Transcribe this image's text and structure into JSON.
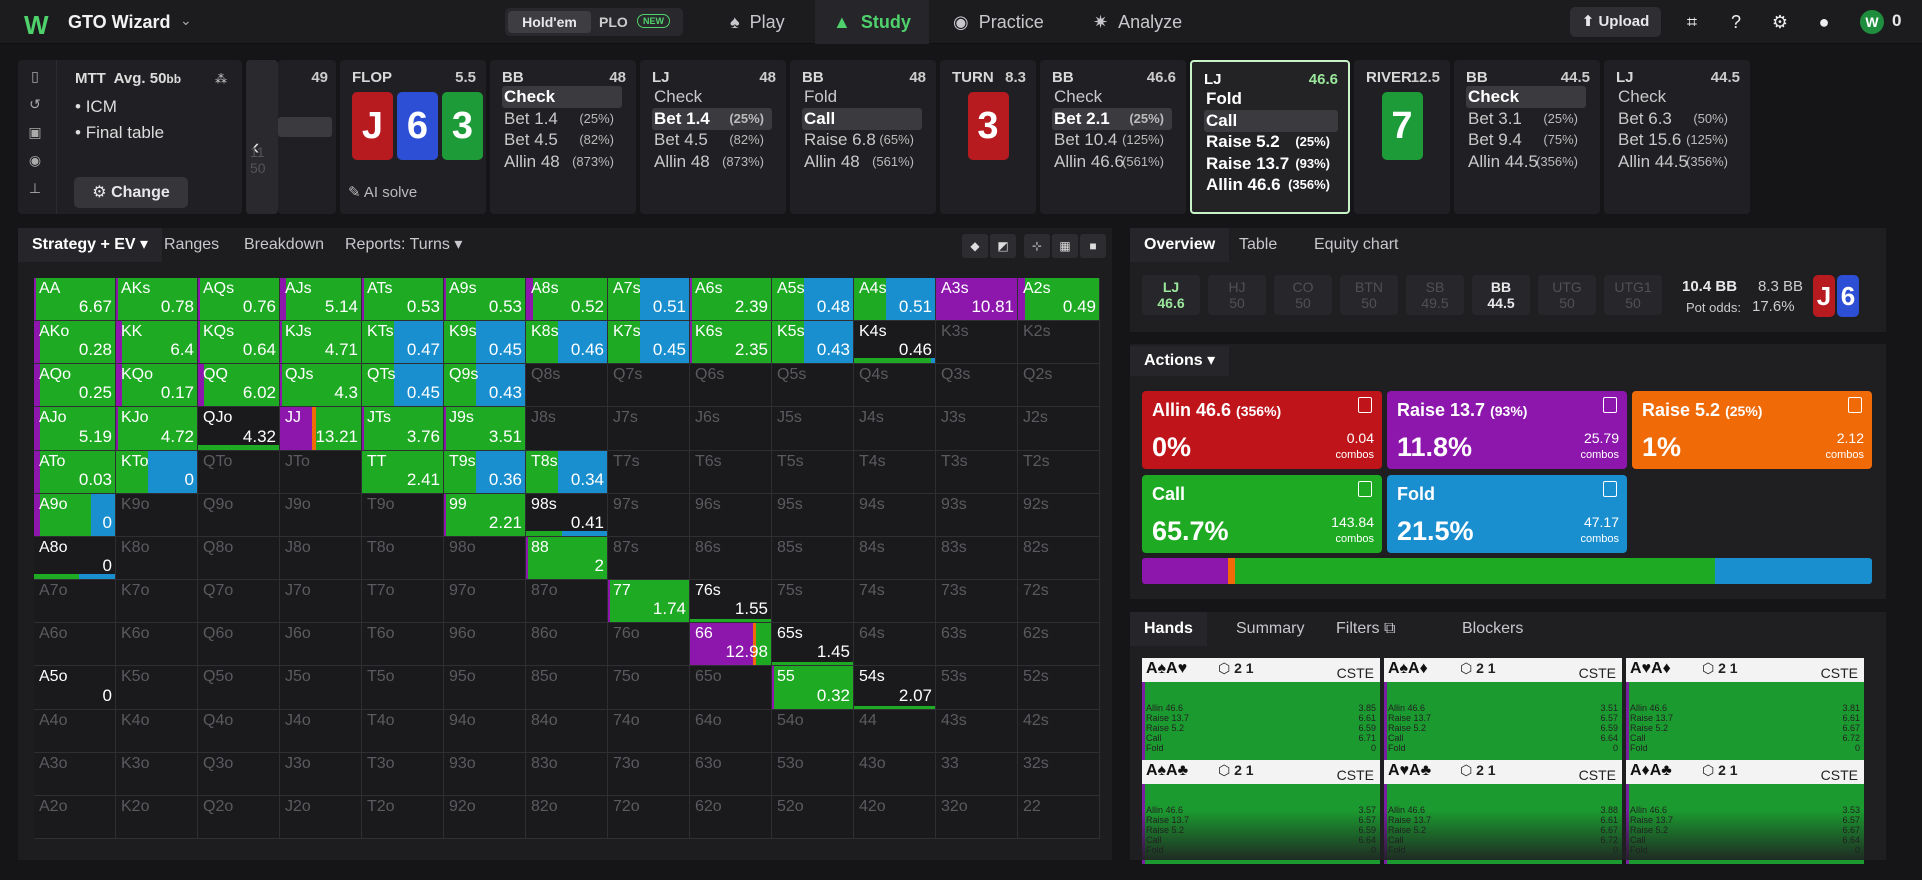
{
  "app": {
    "logo": "W",
    "name": "GTO Wizard",
    "mode_on": "Hold'em",
    "mode_off": "PLO",
    "mode_badge": "NEW",
    "nav": [
      {
        "label": "Play",
        "icon": "spade-icon"
      },
      {
        "label": "Study",
        "icon": "grad-cap-icon"
      },
      {
        "label": "Practice",
        "icon": "gamepad-icon"
      },
      {
        "label": "Analyze",
        "icon": "bulb-icon"
      }
    ],
    "upload": "Upload",
    "coins": "0"
  },
  "colors": {
    "raise_big": "#c0141b",
    "raise": "#8d16ad",
    "raise_small": "#f06a08",
    "call": "#1eaa22",
    "fold": "#1a8fd0",
    "empty": "#1a1a1d"
  },
  "spot": {
    "format": "MTT",
    "avg": "Avg. 50",
    "avg_unit": "bb",
    "bullets": [
      "ICM",
      "Final table"
    ],
    "change": "Change",
    "stack_top": "49",
    "stack_mid": "11",
    "stack_low": "50",
    "ai_solve": "AI solve"
  },
  "street": [
    {
      "pos": "FLOP",
      "num": "5.5",
      "cards": [
        {
          "r": "J",
          "c": "red"
        },
        {
          "r": "6",
          "c": "blue"
        },
        {
          "r": "3",
          "c": "green"
        }
      ]
    },
    {
      "pos": "BB",
      "num": "48",
      "opts": [
        [
          "Check",
          ""
        ],
        [
          "Bet 1.4",
          "(25%)"
        ],
        [
          "Bet 4.5",
          "(82%)"
        ],
        [
          "Allin 48",
          "(873%)"
        ]
      ],
      "sel": 0
    },
    {
      "pos": "LJ",
      "num": "48",
      "opts": [
        [
          "Check",
          ""
        ],
        [
          "Bet 1.4",
          "(25%)"
        ],
        [
          "Bet 4.5",
          "(82%)"
        ],
        [
          "Allin 48",
          "(873%)"
        ]
      ],
      "sel": 1
    },
    {
      "pos": "BB",
      "num": "48",
      "opts": [
        [
          "Fold",
          ""
        ],
        [
          "Call",
          ""
        ],
        [
          "Raise 6.8",
          "(65%)"
        ],
        [
          "Allin 48",
          "(561%)"
        ]
      ],
      "sel": 1
    },
    {
      "pos": "TURN",
      "num": "8.3",
      "cards": [
        {
          "r": "3",
          "c": "red"
        }
      ]
    },
    {
      "pos": "BB",
      "num": "46.6",
      "opts": [
        [
          "Check",
          ""
        ],
        [
          "Bet 2.1",
          "(25%)"
        ],
        [
          "Bet 10.4",
          "(125%)"
        ],
        [
          "Allin 46.6",
          "(561%)"
        ]
      ],
      "sel": 1
    },
    {
      "pos": "LJ",
      "num": "46.6",
      "opts": [
        [
          "Fold",
          ""
        ],
        [
          "Call",
          ""
        ],
        [
          "Raise 5.2",
          "(25%)"
        ],
        [
          "Raise 13.7",
          "(93%)"
        ],
        [
          "Allin 46.6",
          "(356%)"
        ]
      ],
      "sel": 1
    },
    {
      "pos": "RIVER",
      "num": "12.5",
      "cards": [
        {
          "r": "7",
          "c": "green"
        }
      ]
    },
    {
      "pos": "BB",
      "num": "44.5",
      "opts": [
        [
          "Check",
          ""
        ],
        [
          "Bet 3.1",
          "(25%)"
        ],
        [
          "Bet 9.4",
          "(75%)"
        ],
        [
          "Allin 44.5",
          "(356%)"
        ]
      ],
      "sel": 0
    },
    {
      "pos": "LJ",
      "num": "44.5",
      "opts": [
        [
          "Check",
          ""
        ],
        [
          "Bet 6.3",
          "(50%)"
        ],
        [
          "Bet 15.6",
          "(125%)"
        ],
        [
          "Allin 44.5",
          "(356%)"
        ]
      ],
      "sel": -1
    }
  ],
  "strategy": {
    "tabs": [
      "Strategy + EV",
      "Ranges",
      "Breakdown",
      "Reports: Turns"
    ]
  },
  "grid_rows": [
    [
      "AA 6.67 e2",
      "AKs 0.78 e2",
      "AQs 0.76 e2",
      "AJs 5.14 e3",
      "ATs 0.53 e2",
      "A9s 0.53 e2",
      "A8s 0.52 e4",
      "A7s 0.51 e5",
      "A6s 2.39 e2",
      "A5s 0.48 e5",
      "A4s 0.51 e5",
      "A3s 10.81 r1",
      "A2s 0.49 e4"
    ],
    [
      "AKo 0.28 e3",
      "KK 6.4 e3",
      "KQs 0.64 e2",
      "KJs 4.71 e2",
      "KTs 0.47 e5",
      "K9s 0.45 e5",
      "K8s 0.46 e5",
      "K7s 0.45 e5",
      "K6s 2.35 e2",
      "K5s 0.43 e5",
      "K4s 0.46 e6",
      "K3s",
      "K2s"
    ],
    [
      "AQo 0.25 e3",
      "KQo 0.17 e3",
      "QQ 6.02 e3",
      "QJs 4.3 e2",
      "QTs 0.45 e5",
      "Q9s 0.43 e5",
      "Q8s",
      "Q7s",
      "Q6s",
      "Q5s",
      "Q4s",
      "Q3s",
      "Q2s"
    ],
    [
      "AJo 5.19 e3",
      "KJo 4.72 e2",
      "QJo 4.32 e7",
      "JJ 13.21 e8",
      "JTs 3.76 e9",
      "J9s 3.51 e9",
      "J8s",
      "J7s",
      "J6s",
      "J5s",
      "J4s",
      "J3s",
      "J2s"
    ],
    [
      "ATo 0.03 e3",
      "KTo 0 e5",
      "QTo",
      "JTo",
      "TT 2.41 e10",
      "T9s 0.36 e5",
      "T8s 0.34 e5",
      "T7s",
      "T6s",
      "T5s",
      "T4s",
      "T3s",
      "T2s"
    ],
    [
      "A9o 0 e11",
      "K9o",
      "Q9o",
      "J9o",
      "T9o",
      "99 2.21 e2",
      "98s 0.41 e12",
      "97s",
      "96s",
      "95s",
      "94s",
      "93s",
      "92s"
    ],
    [
      "A8o 0 e13",
      "K8o",
      "Q8o",
      "J8o",
      "T8o",
      "98o",
      "88 2 e2",
      "87s",
      "86s",
      "85s",
      "84s",
      "83s",
      "82s"
    ],
    [
      "A7o",
      "K7o",
      "Q7o",
      "J7o",
      "T7o",
      "97o",
      "87o",
      "77 1.74 e2",
      "76s 1.55 e14",
      "75s",
      "74s",
      "73s",
      "72s"
    ],
    [
      "A6o",
      "K6o",
      "Q6o",
      "J6o",
      "T6o",
      "96o",
      "86o",
      "76o",
      "66 12.98 e15",
      "65s 1.45 e14",
      "64s",
      "63s",
      "62s"
    ],
    [
      "A5o 0 e0",
      "K5o",
      "Q5o",
      "J5o",
      "T5o",
      "95o",
      "85o",
      "75o",
      "65o",
      "55 0.32 e2",
      "54s 2.07 e14",
      "53s",
      "52s"
    ],
    [
      "A4o",
      "K4o",
      "Q4o",
      "J4o",
      "T4o",
      "94o",
      "84o",
      "74o",
      "64o",
      "54o",
      "44",
      "43s",
      "42s"
    ],
    [
      "A3o",
      "K3o",
      "Q3o",
      "J3o",
      "T3o",
      "93o",
      "83o",
      "73o",
      "63o",
      "53o",
      "43o",
      "33",
      "32s"
    ],
    [
      "A2o",
      "K2o",
      "Q2o",
      "J2o",
      "T2o",
      "92o",
      "82o",
      "72o",
      "62o",
      "52o",
      "42o",
      "32o",
      "22"
    ]
  ],
  "overview": {
    "tabs": [
      "Overview",
      "Table",
      "Equity chart"
    ],
    "positions": [
      [
        "LJ",
        "46.6"
      ],
      [
        "HJ",
        "50"
      ],
      [
        "CO",
        "50"
      ],
      [
        "BTN",
        "50"
      ],
      [
        "SB",
        "49.5"
      ],
      [
        "BB",
        "44.5"
      ],
      [
        "UTG",
        "50"
      ],
      [
        "UTG1",
        "50"
      ]
    ],
    "pot": "10.4 BB",
    "pot2": "8.3 BB",
    "pot_odds_label": "Pot odds:",
    "pot_odds": "17.6%",
    "cards": [
      {
        "r": "J",
        "c": "red"
      },
      {
        "r": "6",
        "c": "blue"
      }
    ]
  },
  "actions": {
    "label": "Actions",
    "unit": "combos",
    "items": [
      {
        "name": "Allin 46.6",
        "pct": "(356%)",
        "freq": "0%",
        "combos": "0.04",
        "color": "#c0141b"
      },
      {
        "name": "Raise 13.7",
        "pct": "(93%)",
        "freq": "11.8%",
        "combos": "25.79",
        "color": "#8d16ad"
      },
      {
        "name": "Raise 5.2",
        "pct": "(25%)",
        "freq": "1%",
        "combos": "2.12",
        "color": "#f06a08"
      },
      {
        "name": "Call",
        "pct": "",
        "freq": "65.7%",
        "combos": "143.84",
        "color": "#1eaa22"
      },
      {
        "name": "Fold",
        "pct": "",
        "freq": "21.5%",
        "combos": "47.17",
        "color": "#1a8fd0"
      }
    ],
    "bar": [
      0.118,
      0.01,
      0.657,
      0.215
    ]
  },
  "hands": {
    "tabs": [
      "Hands",
      "Summary",
      "Filters",
      "Blockers"
    ],
    "cste": "CSTE",
    "cards": [
      {
        "c": "A♠A♥",
        "v": [
          "3.85",
          "6.61",
          "6.59",
          "6.71",
          "0"
        ]
      },
      {
        "c": "A♠A♦",
        "v": [
          "3.51",
          "6.57",
          "6.59",
          "6.64",
          "0"
        ]
      },
      {
        "c": "A♥A♦",
        "v": [
          "3.81",
          "6.61",
          "6.67",
          "6.72",
          "0"
        ]
      },
      {
        "c": "A♠A♣",
        "v": [
          "3.57",
          "6.57",
          "6.59",
          "6.64",
          "0"
        ]
      },
      {
        "c": "A♥A♣",
        "v": [
          "3.88",
          "6.61",
          "6.67",
          "6.72",
          "0"
        ]
      },
      {
        "c": "A♦A♣",
        "v": [
          "3.53",
          "6.57",
          "6.67",
          "6.64",
          "0"
        ]
      }
    ],
    "lines": [
      "Allin 46.6",
      "Raise 13.7",
      "Raise 5.2",
      "Call",
      "Fold"
    ],
    "badge": "2 1"
  }
}
